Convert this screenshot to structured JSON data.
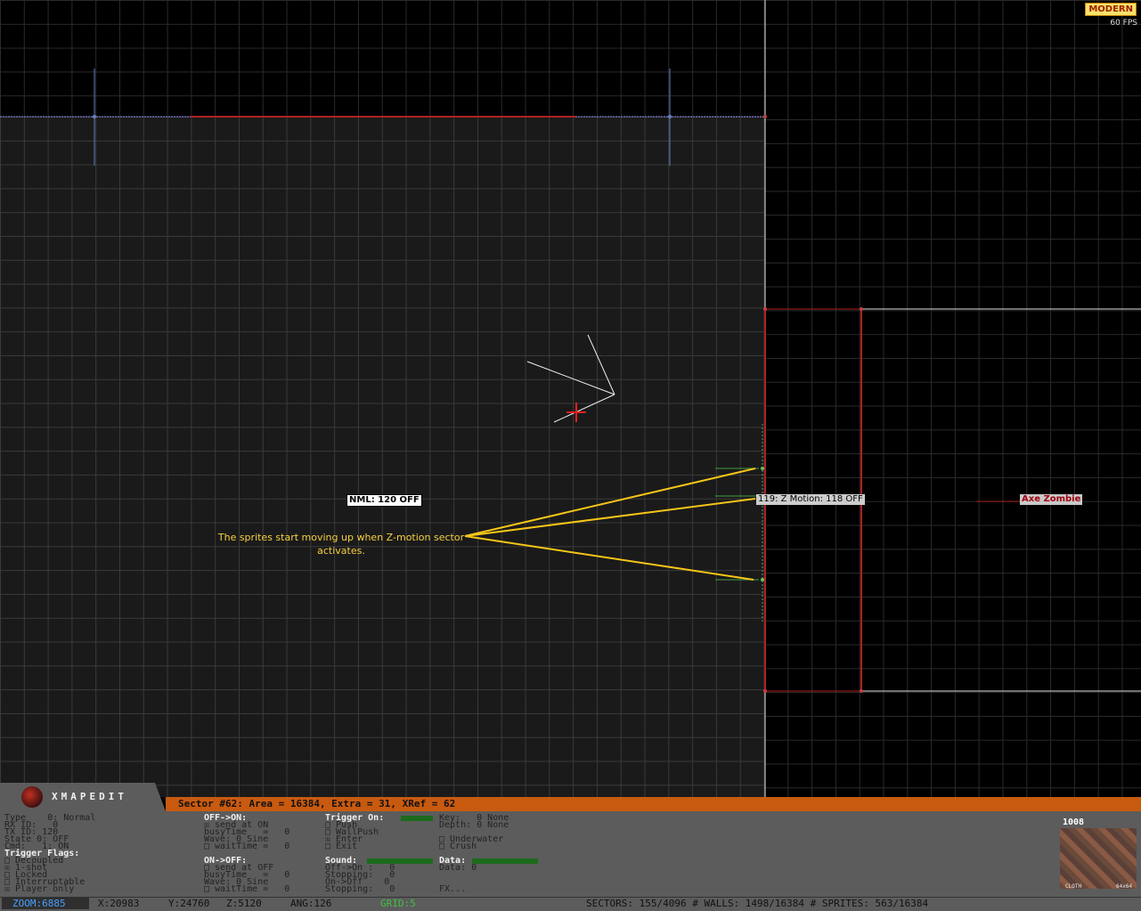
{
  "top_right": {
    "mode_badge": "MODERN",
    "fps": "60 FPS"
  },
  "map": {
    "labels": {
      "nml_tag": "NML: 120 OFF",
      "zmotion_tag": "119: Z Motion: 118 OFF",
      "sprite_tag": "Axe Zombie"
    },
    "note": "The sprites start moving up when Z-motion sector activates."
  },
  "app": {
    "logo_text": "XMAPEDIT"
  },
  "sector_bar": "Sector #62: Area = 16384, Extra = 31, XRef = 62",
  "panel": {
    "col1": [
      "Type    0: Normal",
      "RX ID:   0",
      "TX ID: 120",
      "State 0: OFF",
      "Cmd:   1: ON"
    ],
    "trigger_flags_header": "Trigger Flags:",
    "trigger_flags": [
      "□ Decoupled",
      "☒ 1-shot",
      "□ Locked",
      "□ Interruptable",
      "☒ Player only"
    ],
    "off_on_header": "OFF->ON:",
    "off_on": [
      "☒ send at ON",
      "busyTime   =   0",
      "Wave: 0 Sine",
      "□ waitTime =   0"
    ],
    "on_off_header": "ON->OFF:",
    "on_off": [
      "□ send at OFF",
      "busyTime   =   0",
      "Wave: 0 Sine",
      "□ waitTime =   0"
    ],
    "trigger_on_header": "Trigger On:",
    "trigger_on": [
      "□ Push",
      "□ WallPush",
      "☒ Enter",
      "□ Exit"
    ],
    "sound_header": "Sound:",
    "sound": [
      "Off->On :   0",
      "Stopping:   0",
      "On->Off    0",
      "Stopping:   0"
    ],
    "key_depth": [
      "Key:   0 None",
      "Depth: 0 None"
    ],
    "env": [
      "□ Underwater",
      "□ Crush"
    ],
    "data_header": "Data:",
    "data": [
      "Data: 0",
      "FX..."
    ],
    "texture": {
      "number": "1008",
      "name": "CLOTH",
      "size": "64x64"
    }
  },
  "status": {
    "zoom": "ZOOM:6885",
    "x": "X:20983",
    "y": "Y:24760",
    "z": "Z:5120",
    "ang": "ANG:126",
    "grid": "GRID:5",
    "counts": "SECTORS: 155/4096 # WALLS: 1498/16384 # SPRITES: 563/16384"
  },
  "colors": {
    "sector_bar": "#c85a10",
    "panel": "#5c5c5c",
    "red_wall": "#b02020",
    "arrow": "#f5c518"
  }
}
